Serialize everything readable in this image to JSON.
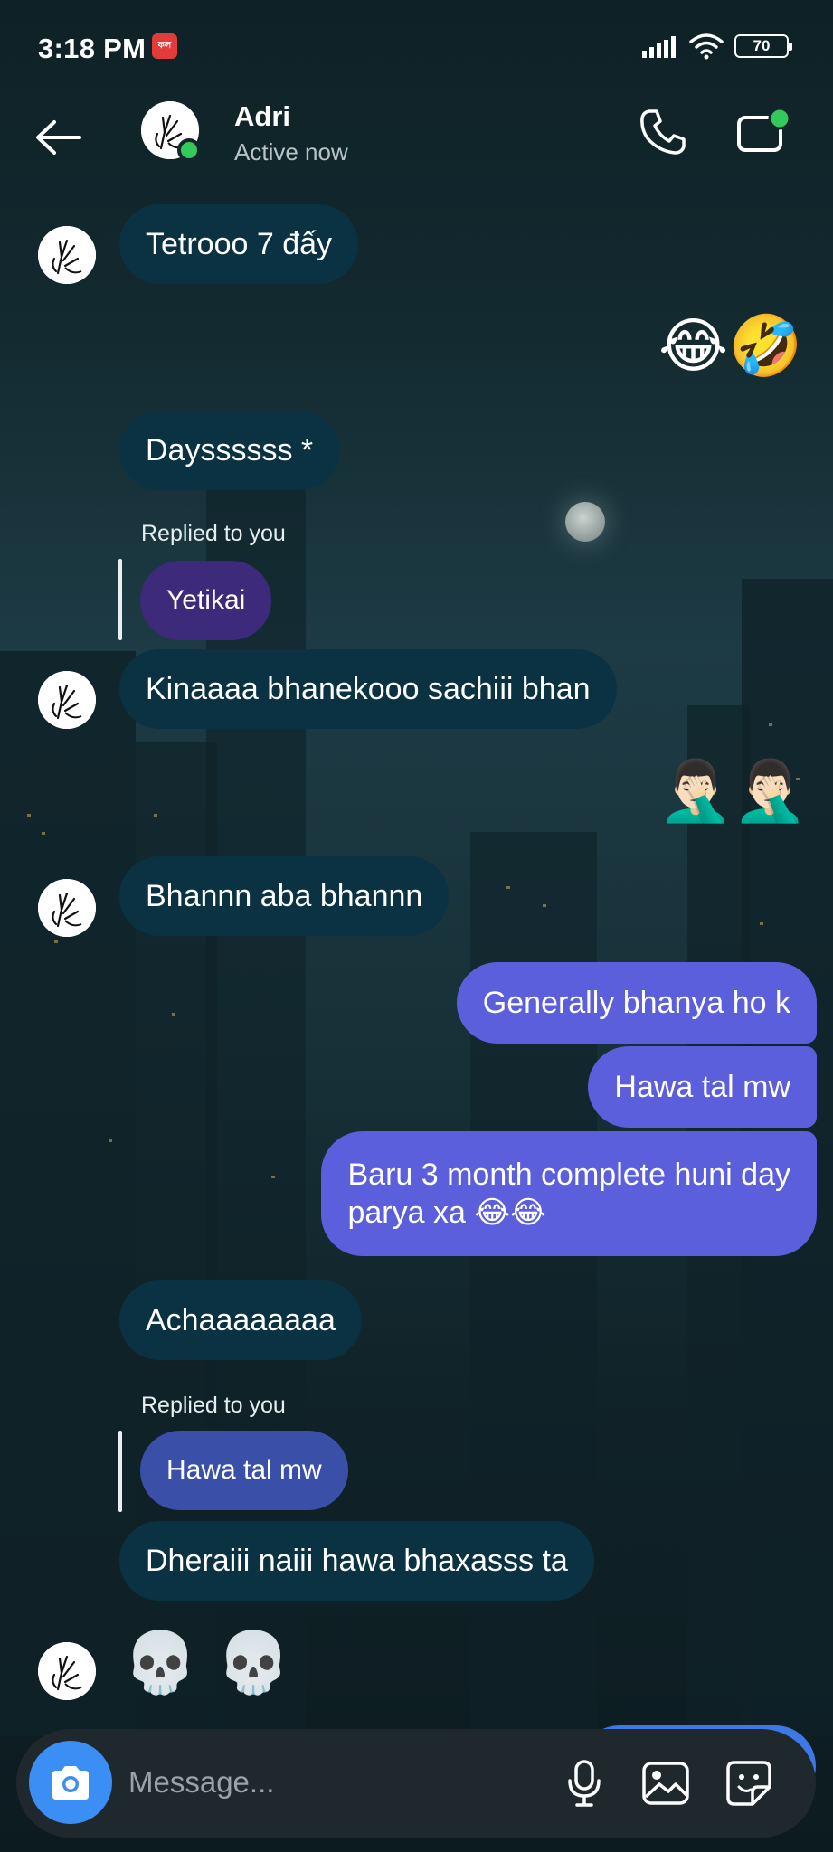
{
  "status_bar": {
    "time": "3:18 PM",
    "app_badge": "কল",
    "battery": "70"
  },
  "header": {
    "contact_name": "Adri",
    "contact_status": "Active now",
    "online_color": "#35c85a"
  },
  "messages": [
    {
      "side": "in",
      "text": "Tetrooo 7 đấy",
      "avatar": true
    },
    {
      "side": "out",
      "emoji": "😂🤣"
    },
    {
      "side": "in",
      "text": "Dayssssss *"
    },
    {
      "side": "in",
      "reply_label": "Replied to you",
      "reply_text": "Yetikai",
      "text": "Kinaaaa bhanekooo sachiii bhan",
      "avatar": true
    },
    {
      "side": "out",
      "emoji": "🤦🏻‍♂️🤦🏻‍♂️"
    },
    {
      "side": "in",
      "text": "Bhannn aba bhannn",
      "avatar": true
    },
    {
      "side": "out",
      "text": "Generally bhanya ho k"
    },
    {
      "side": "out",
      "text": "Hawa tal mw"
    },
    {
      "side": "out",
      "text_line1": "Baru 3 month complete huni day",
      "text_line2": "parya xa 😂😂"
    },
    {
      "side": "in",
      "text": "Achaaaaaaaa"
    },
    {
      "side": "in",
      "reply_label": "Replied to you",
      "reply_text": "Hawa tal mw",
      "text": "Dheraiii naiii hawa bhaxasss ta"
    },
    {
      "side": "in",
      "emoji": "💀 💀",
      "avatar": true
    }
  ],
  "composer": {
    "placeholder": "Message..."
  },
  "colors": {
    "incoming_bubble": "#0a3242",
    "outgoing_bubble": "#5b5fdc",
    "reply_bubble_purple": "#3d2a7a",
    "reply_bubble_blue": "#3a4fa8",
    "camera_button": "#3b8ef3"
  },
  "icons": [
    "back-arrow-icon",
    "phone-icon",
    "video-call-icon",
    "camera-icon",
    "microphone-icon",
    "gallery-icon",
    "sticker-icon",
    "wifi-icon",
    "signal-icon",
    "battery-icon"
  ]
}
